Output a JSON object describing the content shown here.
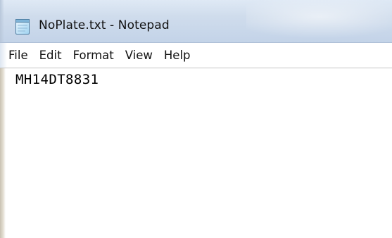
{
  "window": {
    "title": "NoPlate.txt - Notepad",
    "icon": "notepad-icon"
  },
  "menu": {
    "items": [
      {
        "label": "File"
      },
      {
        "label": "Edit"
      },
      {
        "label": "Format"
      },
      {
        "label": "View"
      },
      {
        "label": "Help"
      }
    ]
  },
  "editor": {
    "content": "MH14DT8831"
  },
  "colors": {
    "titlebar": "#cfdcec",
    "menu_border": "#aebfd6",
    "text": "#111111"
  }
}
